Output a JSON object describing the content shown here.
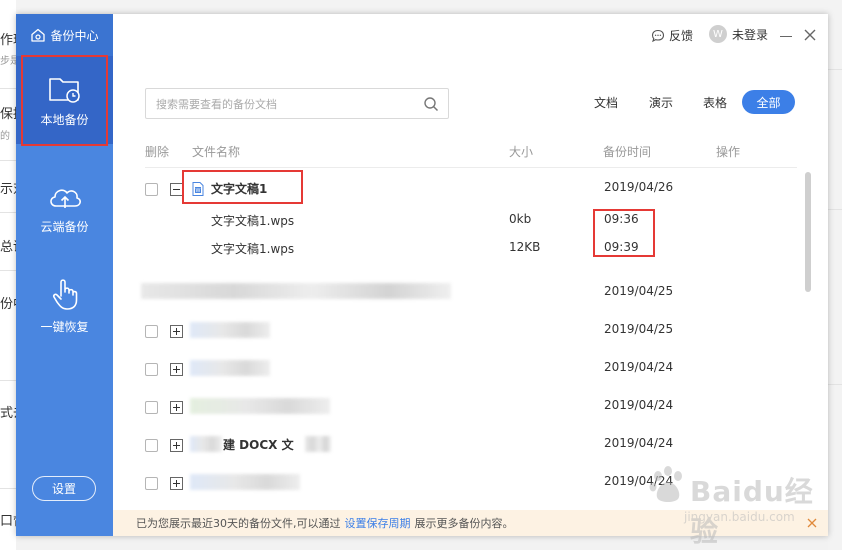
{
  "background_app": {
    "fragments": [
      "作玩",
      "步是",
      "保持",
      "的",
      "示对",
      "总说",
      "份中",
      "式去",
      "口督"
    ]
  },
  "sidebar": {
    "brand": "备份中心",
    "items": [
      {
        "label": "本地备份",
        "icon": "folder-clock-icon",
        "active": true
      },
      {
        "label": "云端备份",
        "icon": "cloud-upload-icon",
        "active": false
      },
      {
        "label": "一键恢复",
        "icon": "hand-pointer-icon",
        "active": false
      }
    ],
    "settings_label": "设置"
  },
  "titlebar": {
    "feedback_label": "反馈",
    "login_label": "未登录"
  },
  "search": {
    "placeholder": "搜索需要查看的备份文档"
  },
  "filters": {
    "doc": "文档",
    "show": "演示",
    "sheet": "表格",
    "all": "全部",
    "selected": "全部"
  },
  "table": {
    "headers": {
      "delete": "删除",
      "name": "文件名称",
      "size": "大小",
      "time": "备份时间",
      "action": "操作"
    },
    "rows": [
      {
        "type": "group",
        "expanded": true,
        "name": "文字文稿1",
        "time": "2019/04/26"
      },
      {
        "type": "child",
        "name": "文字文稿1.wps",
        "size": "0kb",
        "time": "09:36"
      },
      {
        "type": "child",
        "name": "文字文稿1.wps",
        "size": "12KB",
        "time": "09:39"
      },
      {
        "type": "blurred",
        "time": "2019/04/25"
      },
      {
        "type": "group-blurred",
        "time": "2019/04/25"
      },
      {
        "type": "group-blurred",
        "time": "2019/04/24"
      },
      {
        "type": "group-blurred",
        "time": "2019/04/24"
      },
      {
        "type": "group-partial",
        "name": "建 DOCX 文",
        "time": "2019/04/24"
      },
      {
        "type": "group-blurred",
        "time": "2019/04/24"
      }
    ]
  },
  "notice": {
    "text_before": "已为您展示最近30天的备份文件,可以通过",
    "link": "设置保存周期",
    "text_after": "展示更多备份内容。"
  },
  "watermark": {
    "text": "Baidu经验",
    "sub": "jingyan.baidu.com"
  },
  "colors": {
    "sidebar": "#4a86e0",
    "sidebar_active": "#3466c7",
    "accent": "#3c7fe7",
    "highlight": "#e53935",
    "notice_bg": "#fdf2e3"
  }
}
